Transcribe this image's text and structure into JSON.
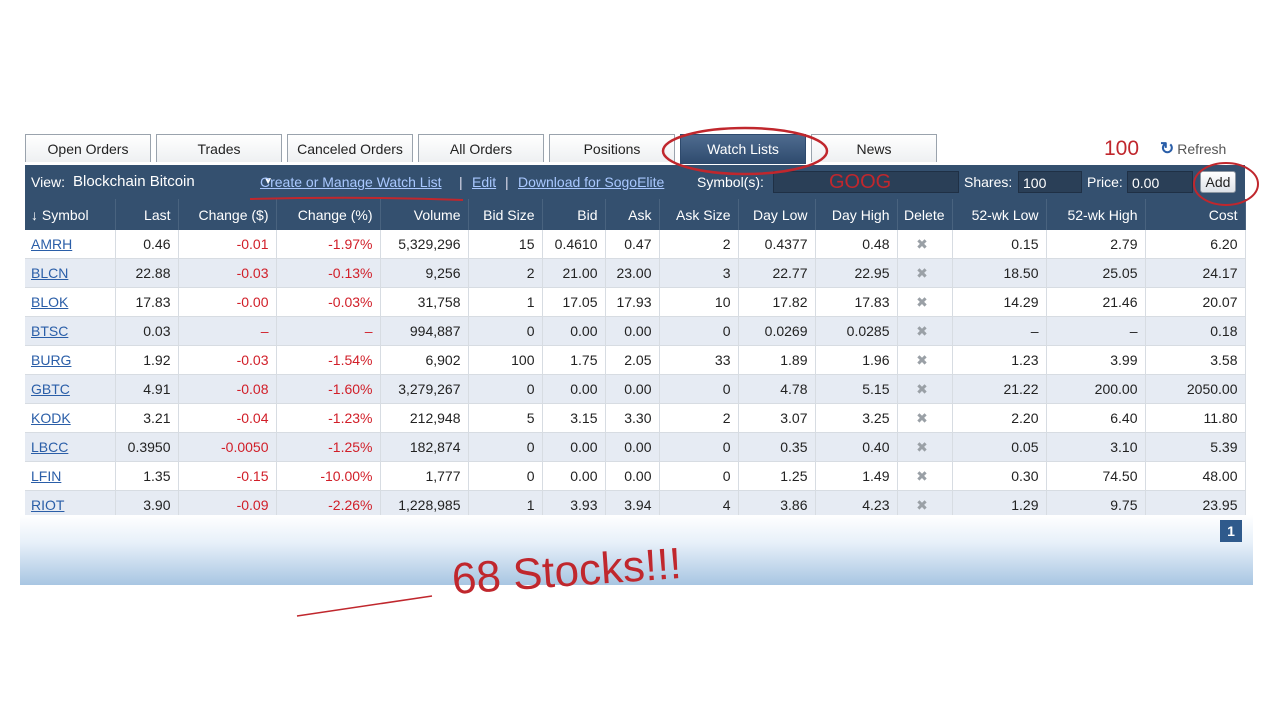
{
  "tabs": [
    "Open Orders",
    "Trades",
    "Canceled Orders",
    "All Orders",
    "Positions",
    "Watch Lists",
    "News"
  ],
  "active_tab": "Watch Lists",
  "refresh_label": "Refresh",
  "annotation_100": "100",
  "toolbar": {
    "view_label": "View:",
    "view_value": "Blockchain Bitcoin",
    "create_link": "Create or Manage Watch List",
    "edit_link": "Edit",
    "download_link": "Download for SogoElite",
    "symbols_label": "Symbol(s):",
    "symbols_value": "GOOG",
    "shares_label": "Shares:",
    "shares_value": "100",
    "price_label": "Price:",
    "price_value": "0.00",
    "add_label": "Add",
    "separator": "|"
  },
  "table": {
    "headers": [
      "↓ Symbol",
      "Last",
      "Change ($)",
      "Change (%)",
      "Volume",
      "Bid Size",
      "Bid",
      "Ask",
      "Ask Size",
      "Day Low",
      "Day High",
      "Delete",
      "52-wk Low",
      "52-wk High",
      "Cost"
    ],
    "rows": [
      [
        "AMRH",
        "0.46",
        "-0.01",
        "-1.97%",
        "5,329,296",
        "15",
        "0.4610",
        "0.47",
        "2",
        "0.4377",
        "0.48",
        "✖",
        "0.15",
        "2.79",
        "6.20"
      ],
      [
        "BLCN",
        "22.88",
        "-0.03",
        "-0.13%",
        "9,256",
        "2",
        "21.00",
        "23.00",
        "3",
        "22.77",
        "22.95",
        "✖",
        "18.50",
        "25.05",
        "24.17"
      ],
      [
        "BLOK",
        "17.83",
        "-0.00",
        "-0.03%",
        "31,758",
        "1",
        "17.05",
        "17.93",
        "10",
        "17.82",
        "17.83",
        "✖",
        "14.29",
        "21.46",
        "20.07"
      ],
      [
        "BTSC",
        "0.03",
        "–",
        "–",
        "994,887",
        "0",
        "0.00",
        "0.00",
        "0",
        "0.0269",
        "0.0285",
        "✖",
        "–",
        "–",
        "0.18"
      ],
      [
        "BURG",
        "1.92",
        "-0.03",
        "-1.54%",
        "6,902",
        "100",
        "1.75",
        "2.05",
        "33",
        "1.89",
        "1.96",
        "✖",
        "1.23",
        "3.99",
        "3.58"
      ],
      [
        "GBTC",
        "4.91",
        "-0.08",
        "-1.60%",
        "3,279,267",
        "0",
        "0.00",
        "0.00",
        "0",
        "4.78",
        "5.15",
        "✖",
        "21.22",
        "200.00",
        "2050.00"
      ],
      [
        "KODK",
        "3.21",
        "-0.04",
        "-1.23%",
        "212,948",
        "5",
        "3.15",
        "3.30",
        "2",
        "3.07",
        "3.25",
        "✖",
        "2.20",
        "6.40",
        "11.80"
      ],
      [
        "LBCC",
        "0.3950",
        "-0.0050",
        "-1.25%",
        "182,874",
        "0",
        "0.00",
        "0.00",
        "0",
        "0.35",
        "0.40",
        "✖",
        "0.05",
        "3.10",
        "5.39"
      ],
      [
        "LFIN",
        "1.35",
        "-0.15",
        "-10.00%",
        "1,777",
        "0",
        "0.00",
        "0.00",
        "0",
        "1.25",
        "1.49",
        "✖",
        "0.30",
        "74.50",
        "48.00"
      ],
      [
        "RIOT",
        "3.90",
        "-0.09",
        "-2.26%",
        "1,228,985",
        "1",
        "3.93",
        "3.94",
        "4",
        "3.86",
        "4.23",
        "✖",
        "1.29",
        "9.75",
        "23.95"
      ]
    ]
  },
  "pager_page": "1",
  "annotation_stocks": "68 Stocks!!!",
  "colors": {
    "header_bg": "#34506f",
    "link": "#2a5ea8",
    "negative": "#d11e28",
    "annotation": "#c0272d"
  }
}
